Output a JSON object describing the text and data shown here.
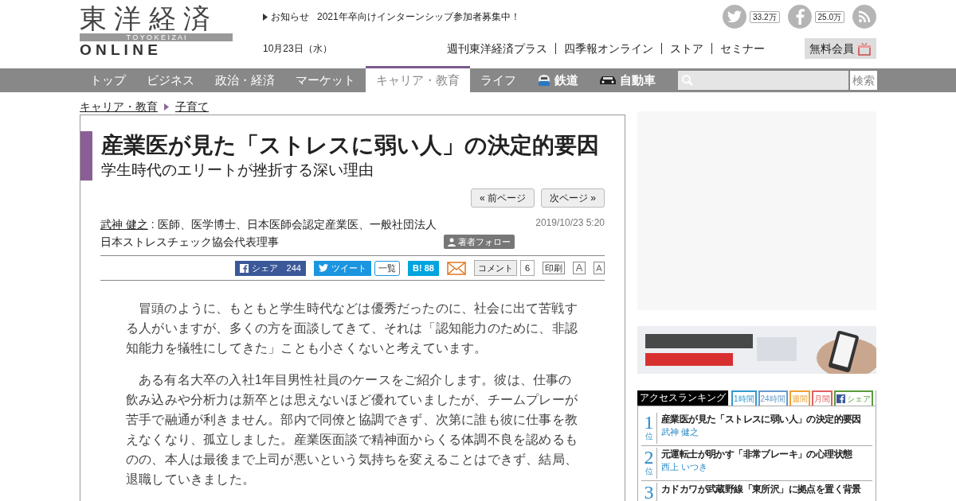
{
  "logo": {
    "kanji": "東 洋 経 済",
    "roman": "T O Y O K E I Z A I",
    "online": "O N L I N E"
  },
  "notice": {
    "label": "お知らせ",
    "text": "2021年卒向けインターンシップ参加者募集中！"
  },
  "date": "10月23日（水）",
  "social": [
    {
      "kind": "twitter",
      "count": "33.2万"
    },
    {
      "kind": "facebook",
      "count": "25.0万"
    },
    {
      "kind": "rss"
    }
  ],
  "header_links": [
    "週刊東洋経済プラス",
    "四季報オンライン",
    "ストア",
    "セミナー"
  ],
  "member_button": "無料会員",
  "nav": [
    {
      "label": "トップ",
      "selected": false
    },
    {
      "label": "ビジネス",
      "selected": false
    },
    {
      "label": "政治・経済",
      "selected": false
    },
    {
      "label": "マーケット",
      "selected": false
    },
    {
      "label": "キャリア・教育",
      "selected": true
    },
    {
      "label": "ライフ",
      "selected": false
    },
    {
      "label": "鉄道",
      "selected": false,
      "kind": "train"
    },
    {
      "label": "自動車",
      "selected": false,
      "kind": "car"
    }
  ],
  "search": {
    "button": "検索"
  },
  "breadcrumb": [
    "キャリア・教育",
    "子育て"
  ],
  "article": {
    "title": "産業医が見た「ストレスに弱い人」の決定的要因",
    "subtitle": "学生時代のエリートが挫折する深い理由",
    "pager": [
      "« 前ページ",
      "次ページ »"
    ],
    "author": "武神 健之",
    "author_desc": " : 医師、医学博士、日本医師会認定産業医、一般社団法人日本ストレスチェック協会代表理事",
    "follow": "著者フォロー",
    "datetime": "2019/10/23 5:20",
    "share": {
      "facebook": "シェア",
      "facebook_count": "244",
      "tweet": "ツイート",
      "list": "一覧",
      "hatena": "B!",
      "hatena_count": "88",
      "comment": "コメント",
      "comment_count": "6",
      "print": "印刷",
      "font_large": "A",
      "font_small": "A"
    },
    "paragraphs": [
      "冒頭のように、もともと学生時代などは優秀だったのに、社会に出て苦戦する人がいますが、多くの方を面談してきて、それは「認知能力のために、非認知能力を犠牲にしてきた」ことも小さくないと考えています。",
      "ある有名大卒の入社1年目男性社員のケースをご紹介します。彼は、仕事の飲み込みや分析力は新卒とは思えないほど優れていましたが、チームプレーが苦手で融通が利きません。部内で同僚と協調できず、次第に誰も彼に仕事を教えなくなり、孤立しました。産業医面談で精神面からくる体調不良を認めるものの、本人は最後まで上司が悪いという気持ちを変えることはできず、結局、退職していきました。"
    ]
  },
  "ranking": {
    "title": "アクセスランキング",
    "tabs": [
      {
        "label": "1時間",
        "color": "#3399cc"
      },
      {
        "label": "24時間",
        "color": "#6699cc"
      },
      {
        "label": "週間",
        "color": "#f0a030"
      },
      {
        "label": "月間",
        "color": "#e06060"
      },
      {
        "label": "シェア",
        "color": "#5a9a3a",
        "kind": "facebook"
      }
    ],
    "items": [
      {
        "rank": "1",
        "unit": "位",
        "title": "産業医が見た「ストレスに弱い人」の決定的要因",
        "author": "武神 健之"
      },
      {
        "rank": "2",
        "unit": "位",
        "title": "元運転士が明かす「非常ブレーキ」の心理状態",
        "author": "西上 いつき"
      },
      {
        "rank": "3",
        "title": "カドカワが武蔵野線「東所沢」に拠点を置く背景"
      }
    ]
  }
}
